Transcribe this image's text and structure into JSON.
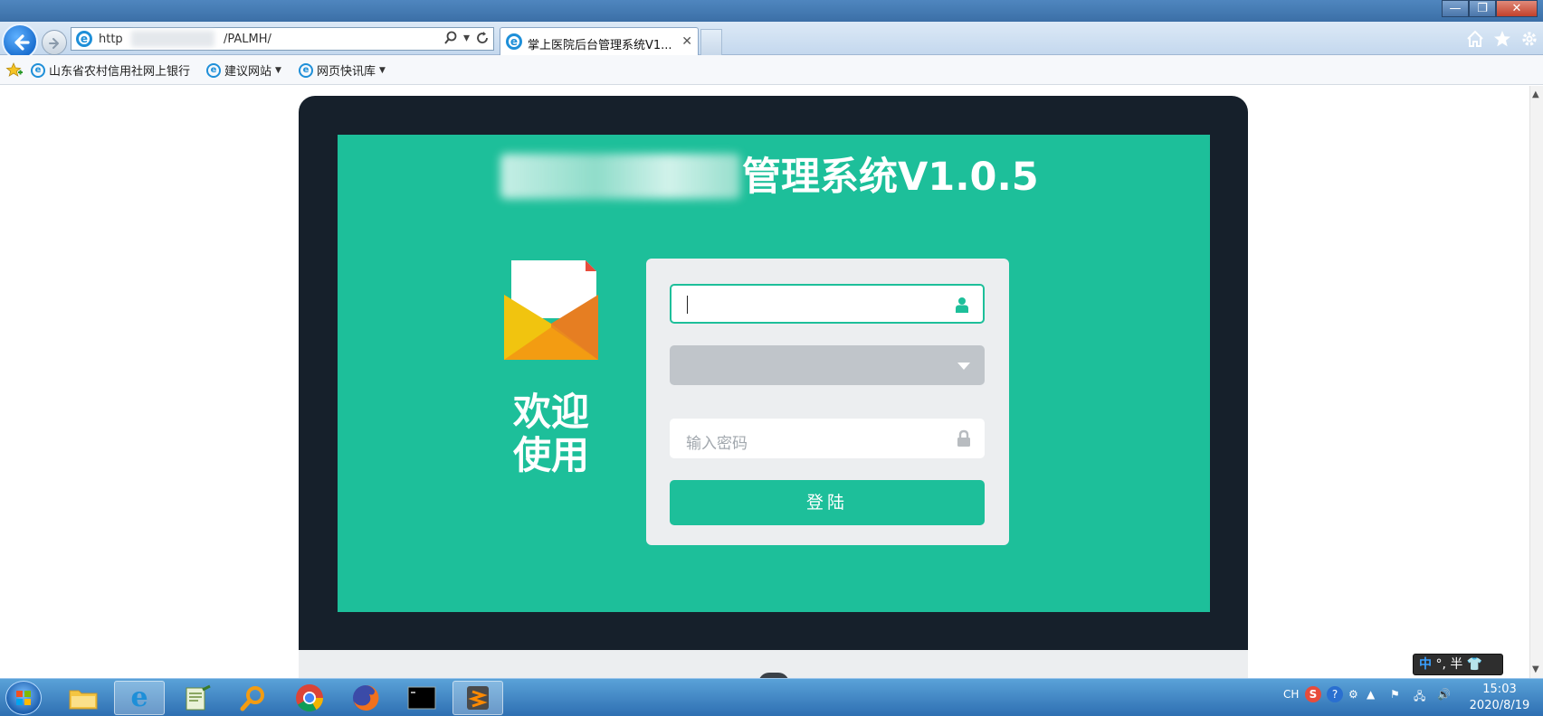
{
  "browser": {
    "url_prefix": "http",
    "url_path": "/PALMH/",
    "tab_title": "掌上医院后台管理系统V1....",
    "favorites": [
      {
        "label": "山东省农村信用社网上银行"
      },
      {
        "label": "建议网站"
      },
      {
        "label": "网页快讯库"
      }
    ]
  },
  "app": {
    "system_title": "管理系统V1.0.5",
    "welcome_text": "欢迎使用",
    "password_placeholder": "输入密码",
    "login_button": "登陆"
  },
  "ime": {
    "zh": "中",
    "rest": "°, 半"
  },
  "taskbar": {
    "lang": "CH",
    "time": "15:03",
    "date": "2020/8/19"
  },
  "colors": {
    "accent": "#1dbf9a",
    "monitor": "#16202b",
    "card": "#eceef0"
  }
}
